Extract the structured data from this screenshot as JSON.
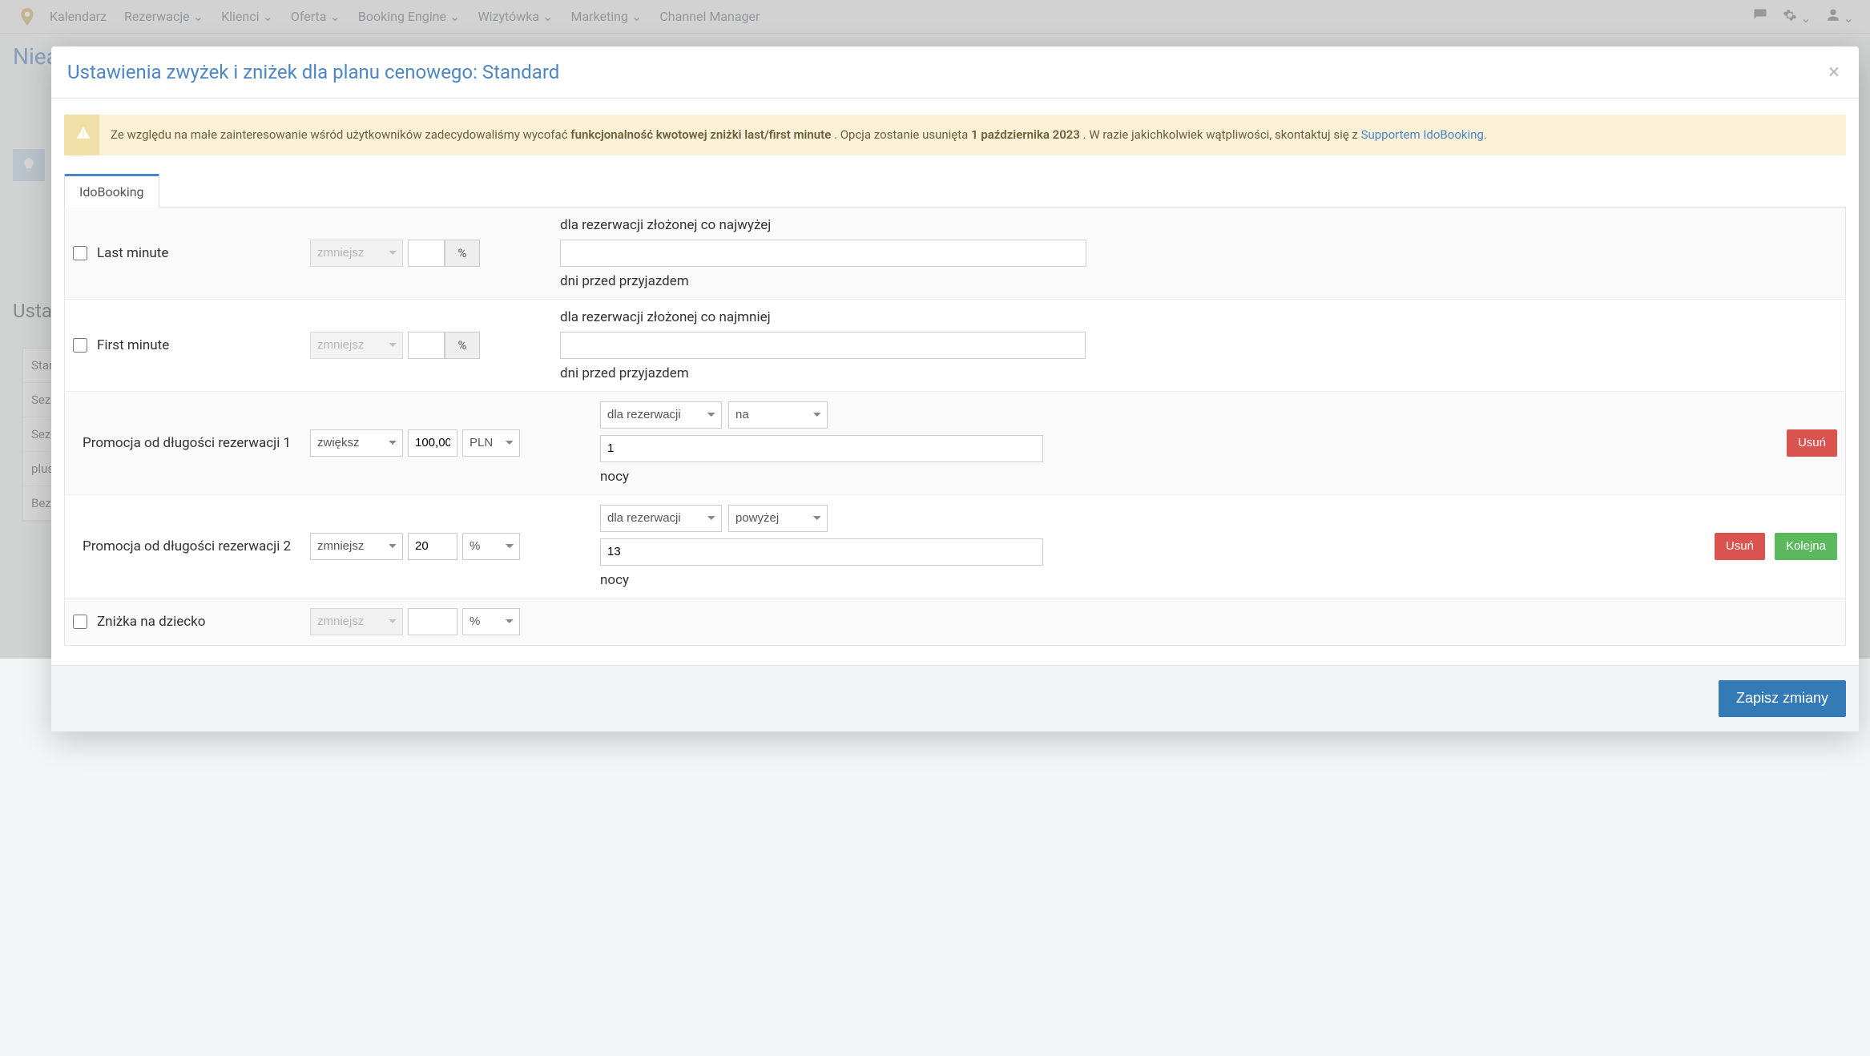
{
  "nav": {
    "items": [
      "Kalendarz",
      "Rezerwacje",
      "Klienci",
      "Oferta",
      "Booking Engine",
      "Wizytówka",
      "Marketing",
      "Channel Manager"
    ]
  },
  "page": {
    "title": "Nieaktywne pakiety",
    "section_title": "Usta",
    "side_list": [
      "Stanc",
      "Sezor",
      "Sezor",
      "plus",
      "Bezzv"
    ]
  },
  "modal": {
    "title": "Ustawienia zwyżek i zniżek dla planu cenowego: Standard",
    "alert": {
      "text_1": "Ze względu na małe zainteresowanie wśród użytkowników zadecydowaliśmy wycofać ",
      "bold_1": "funkcjonalność kwotowej zniżki last/first minute",
      "text_2": ". Opcja zostanie usunięta ",
      "bold_2": "1 października 2023",
      "text_3": ". W razie jakichkolwiek wątpliwości, skontaktuj się z ",
      "link": "Supportem IdoBooking",
      "text_4": "."
    },
    "tab": "IdoBooking",
    "rows": {
      "last_minute": {
        "label": "Last minute",
        "op": "zmniejsz",
        "value": "",
        "unit": "%",
        "desc_1": "dla rezerwacji złożonej co najwyżej",
        "days": "",
        "desc_2": "dni przed przyjazdem"
      },
      "first_minute": {
        "label": "First minute",
        "op": "zmniejsz",
        "value": "",
        "unit": "%",
        "desc_1": "dla rezerwacji złożonej co najmniej",
        "days": "",
        "desc_2": "dni przed przyjazdem"
      },
      "promo1": {
        "label": "Promocja od długości rezerwacji 1",
        "op": "zwiększ",
        "value": "100,00",
        "unit": "PLN",
        "scope": "dla rezerwacji",
        "cond": "na",
        "nights": "1",
        "nights_label": "nocy",
        "delete": "Usuń"
      },
      "promo2": {
        "label": "Promocja od długości rezerwacji 2",
        "op": "zmniejsz",
        "value": "20",
        "unit": "%",
        "scope": "dla rezerwacji",
        "cond": "powyżej",
        "nights": "13",
        "nights_label": "nocy",
        "delete": "Usuń",
        "next": "Kolejna"
      },
      "child": {
        "label": "Zniżka na dziecko",
        "op": "zmniejsz",
        "value": "",
        "unit": "%"
      }
    },
    "save": "Zapisz zmiany"
  }
}
